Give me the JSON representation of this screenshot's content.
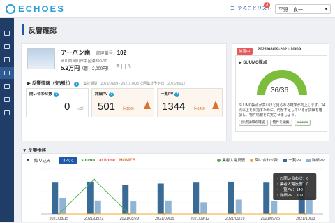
{
  "header": {
    "logo": "ECHOES",
    "todo_label": "やることリスト",
    "todo_count": "3",
    "user_name": "平野　良一"
  },
  "page": {
    "title": "反響確認"
  },
  "property": {
    "name": "アーバン南",
    "room_label": "部屋番号：",
    "room": "102",
    "address": "岡山県岡山市中区瀬390-10",
    "price": "5.2万円",
    "price_sub": "（管：2,000円）",
    "chip1": "新",
    "chip2": "礼"
  },
  "response_section": {
    "title": "反響情報（先週比）",
    "note": "集計期間：2021/09/09 - 2021/10/03 次回集計予定日：2021/10/12"
  },
  "kpis": [
    {
      "label": "問い合わせ数",
      "value": "0",
      "delta": "（±0）"
    },
    {
      "label": "詳細PV",
      "value": "501",
      "delta": "（+109）"
    },
    {
      "label": "一覧PV",
      "value": "1344",
      "delta": "（+143）"
    }
  ],
  "suumo": {
    "tag": "前週中",
    "period": "2021/08/09-2021/10/09",
    "title": "SUUMO採点",
    "score": "36",
    "max": "36",
    "desc": "SUUMO採点が高いほど見られる確率が向上します。34点以上を目指すために、何が不足しているか詳細を確認し、物件情報を充実させましょう。",
    "btn1": "採点詳細の確認",
    "btn2": "物件を編集",
    "btn3": "suumo"
  },
  "trend": {
    "title": "反響推移",
    "filter_label": "絞り込み：",
    "filter_all": "すべて",
    "filter_suumo": "suumo",
    "filter_athome": "at home",
    "filter_homes": "HOME'S"
  },
  "tooltip": {
    "l1": "・お問い合わせ：0",
    "l2": "・業者入電反響：0",
    "l3": "・一覧PV：143",
    "l4": "・詳細PV：109"
  },
  "colors": {
    "bar_list": "#3a6a96",
    "bar_detail": "#8fb4d4",
    "line_gyosha": "#4caf50",
    "line_inquiry": "#f0a830",
    "accent": "#1f5aa8"
  },
  "chart_data": {
    "type": "bar",
    "categories": [
      "2021/08/15",
      "2021/08/22",
      "2021/08/29",
      "2021/09/05",
      "2021/09/12",
      "2021/09/19",
      "2021/09/26",
      "2021/10/03"
    ],
    "ylim": [
      0,
      1000
    ],
    "series": [
      {
        "name": "業者入電反響",
        "type": "line",
        "values": [
          0,
          2,
          0,
          0,
          0,
          0,
          0,
          0
        ]
      },
      {
        "name": "問い合わせ数",
        "type": "line",
        "values": [
          0,
          0,
          0,
          0,
          0,
          0,
          0,
          0
        ]
      },
      {
        "name": "一覧PV",
        "type": "bar",
        "values": [
          700,
          720,
          650,
          680,
          700,
          720,
          700,
          700
        ]
      },
      {
        "name": "詳細PV",
        "type": "bar",
        "values": [
          360,
          300,
          280,
          300,
          260,
          320,
          290,
          370
        ]
      }
    ]
  }
}
